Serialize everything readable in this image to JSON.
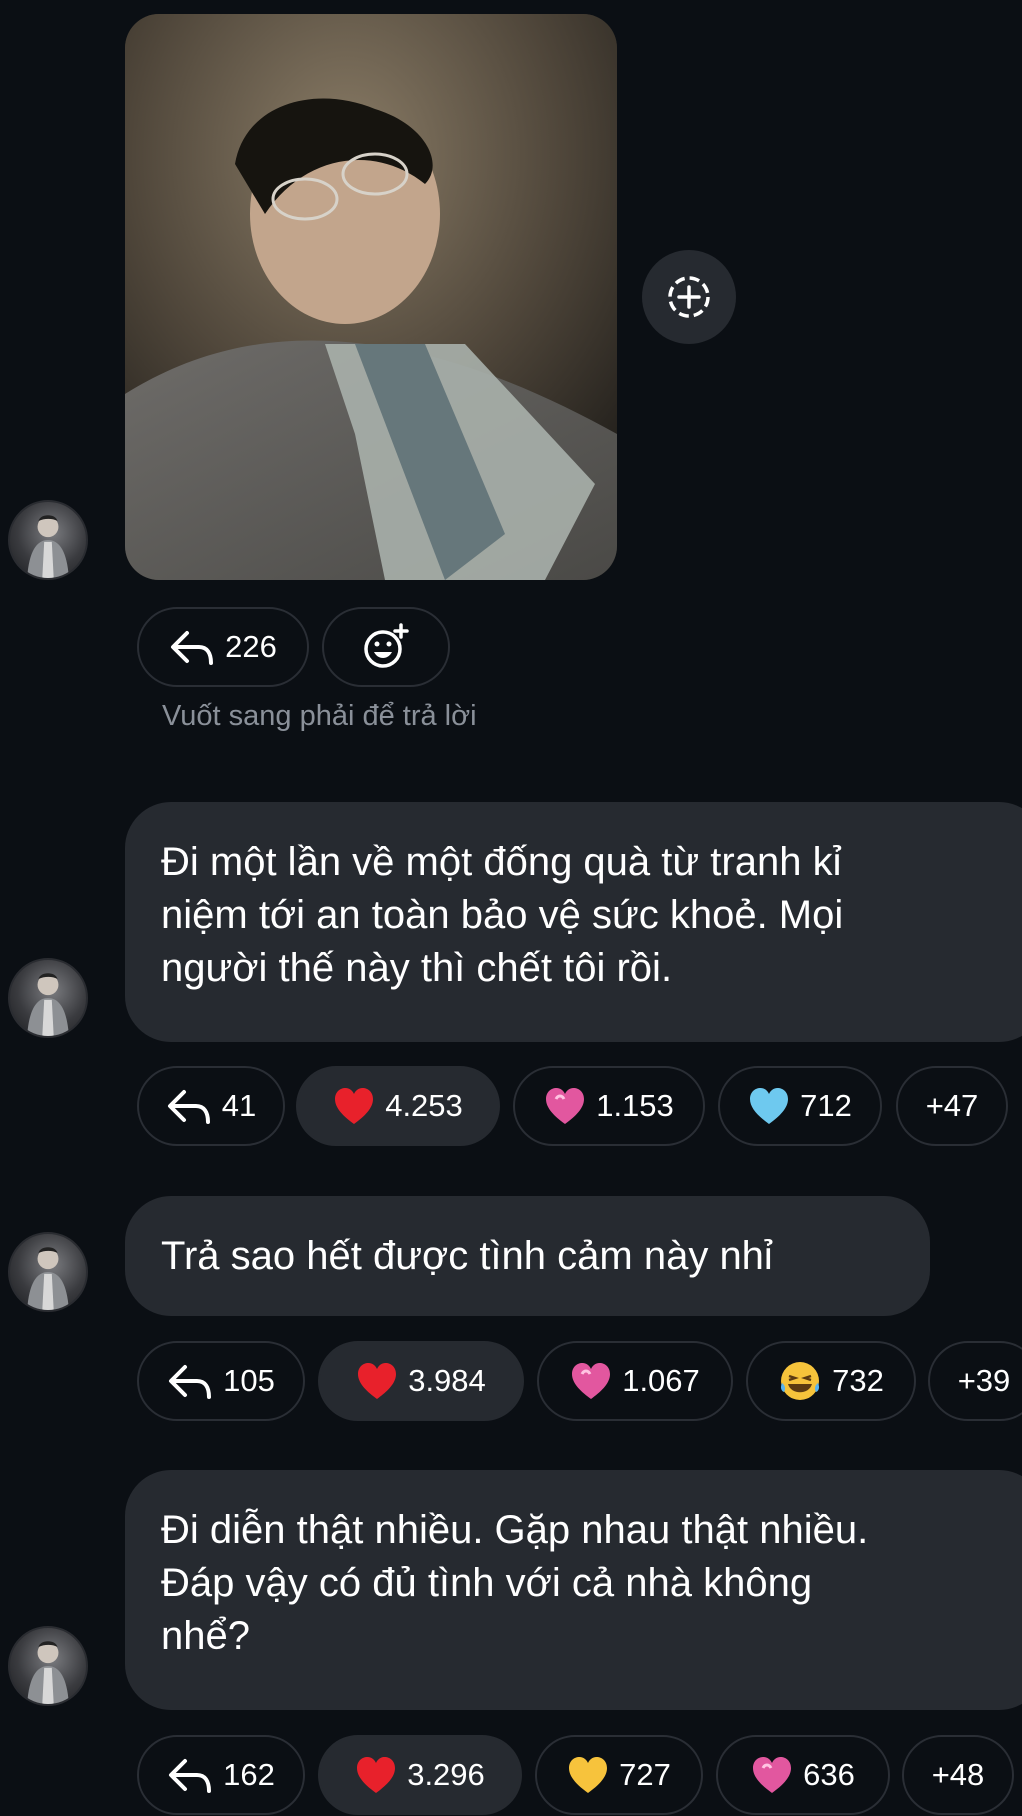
{
  "story_reply": {
    "reply_count": "226",
    "hint": "Vuốt sang phải để trả lời"
  },
  "messages": [
    {
      "text": "Đi một lần về một đống quà từ tranh kỉ\nniệm tới an toàn bảo vệ sức khoẻ. Mọi\nngười thế này thì chết tôi rồi.",
      "replies": "41",
      "reactions": [
        {
          "emoji": "red-heart",
          "count": "4.253"
        },
        {
          "emoji": "pink-heart",
          "count": "1.153"
        },
        {
          "emoji": "blue-heart",
          "count": "712"
        }
      ],
      "more": "+47"
    },
    {
      "text": "Trả sao hết được tình cảm này nhỉ",
      "replies": "105",
      "reactions": [
        {
          "emoji": "red-heart",
          "count": "3.984"
        },
        {
          "emoji": "pink-heart",
          "count": "1.067"
        },
        {
          "emoji": "laughing-face",
          "count": "732"
        }
      ],
      "more": "+39"
    },
    {
      "text": "Đi diễn thật nhiều. Gặp nhau thật nhiều.\nĐáp vậy có đủ tình với cả nhà không\nnhể?",
      "replies": "162",
      "reactions": [
        {
          "emoji": "red-heart",
          "count": "3.296"
        },
        {
          "emoji": "yellow-heart",
          "count": "727"
        },
        {
          "emoji": "pink-heart",
          "count": "636"
        }
      ],
      "more": "+48"
    }
  ],
  "colors": {
    "background": "#0b0f14",
    "bubble": "#262a30",
    "pill_border": "#2a2e35",
    "hint_text": "#8a9099"
  }
}
